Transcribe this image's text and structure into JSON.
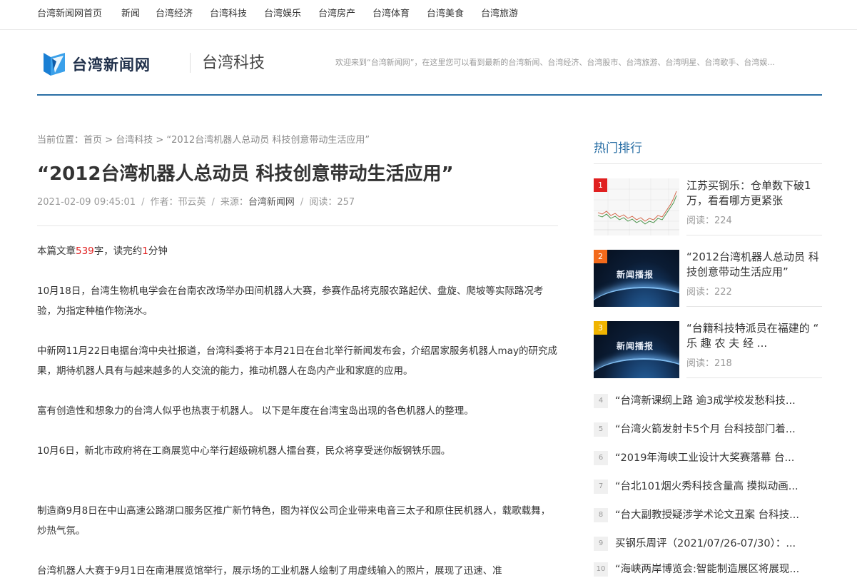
{
  "topnav": [
    "台湾新闻网首页",
    "新闻",
    "台湾经济",
    "台湾科技",
    "台湾娱乐",
    "台湾房产",
    "台湾体育",
    "台湾美食",
    "台湾旅游"
  ],
  "header": {
    "logo_text": "台湾新闻网",
    "section_title": "台湾科技",
    "welcome": "欢迎来到“台湾新闻网”，在这里您可以看到最新的台湾新闻、台湾经济、台湾股市、台湾旅游、台湾明星、台湾歌手、台湾娱..."
  },
  "breadcrumb": {
    "label": "当前位置：",
    "home": "首页",
    "sep": " > ",
    "category": "台湾科技",
    "current": "“2012台湾机器人总动员 科技创意带动生活应用”"
  },
  "article": {
    "title": "“2012台湾机器人总动员 科技创意带动生活应用”",
    "date": "2021-02-09 09:45:01",
    "author_label": "作者：",
    "author": "邗云英",
    "source_label": "来源：",
    "source": "台湾新闻网",
    "read_label": "阅读：",
    "reads": "257",
    "meta_sep": "/",
    "wordcount_prefix": "本篇文章",
    "wordcount": "539",
    "wordcount_mid": "字，读完约",
    "minutes": "1",
    "minutes_suffix": "分钟",
    "paragraphs": [
      "10月18日，台湾生物机电学会在台南农改场举办田间机器人大赛，参赛作品将克服农路起伏、盘旋、爬坡等实际路况考验，为指定种植作物浇水。",
      "中新网11月22日电据台湾中央社报道，台湾科委将于本月21日在台北举行新闻发布会，介绍居家服务机器人may的研究成果，期待机器人具有与越来越多的人交流的能力，推动机器人在岛内产业和家庭的应用。",
      "富有创造性和想象力的台湾人似乎也热衷于机器人。 以下是年度在台湾宝岛出现的各色机器人的整理。",
      "10月6日，新北市政府将在工商展览中心举行超级碗机器人擂台赛，民众将享受迷你版钢铁乐园。",
      "制造商9月8日在中山高速公路湖口服务区推广新竹特色，图为祥仪公司企业带来电音三太子和原住民机器人，载歌载舞，炒热气氛。",
      "台湾机器人大赛于9月1日在南港展览馆举行，展示场的工业机器人绘制了用虚线输入的照片，展现了迅速、准"
    ]
  },
  "sidebar": {
    "title": "热门排行",
    "read_label": "阅读：",
    "hot": [
      {
        "rank": "1",
        "title": "江苏买钢乐：仓单数下破1万，看看哪方更紧张",
        "reads": "224",
        "badge_color": "#e02020"
      },
      {
        "rank": "2",
        "title": "“2012台湾机器人总动员 科技创意带动生活应用”",
        "reads": "222",
        "badge_color": "#f26a1b",
        "thumb_label": "新闻播报"
      },
      {
        "rank": "3",
        "title": "“台籍科技特派员在福建的 “ 乐 趣 农 夫 经 ...",
        "reads": "218",
        "badge_color": "#f0b400",
        "thumb_label": "新闻播报"
      }
    ],
    "list": [
      {
        "rank": "4",
        "title": "“台湾新课纲上路 逾3成学校发愁科技..."
      },
      {
        "rank": "5",
        "title": "“台湾火箭发射卡5个月 台科技部门着..."
      },
      {
        "rank": "6",
        "title": "“2019年海峡工业设计大奖赛落幕 台..."
      },
      {
        "rank": "7",
        "title": "“台北101烟火秀科技含量高 摸拟动画..."
      },
      {
        "rank": "8",
        "title": "“台大副教授疑涉学术论文丑案 台科技..."
      },
      {
        "rank": "9",
        "title": "买钢乐周评（2021/07/26-07/30）：..."
      },
      {
        "rank": "10",
        "title": "“海峡两岸博览会:智能制造展区将展现..."
      }
    ]
  },
  "colors": {
    "accent": "#2a6fa5",
    "highlight": "#e02020"
  }
}
